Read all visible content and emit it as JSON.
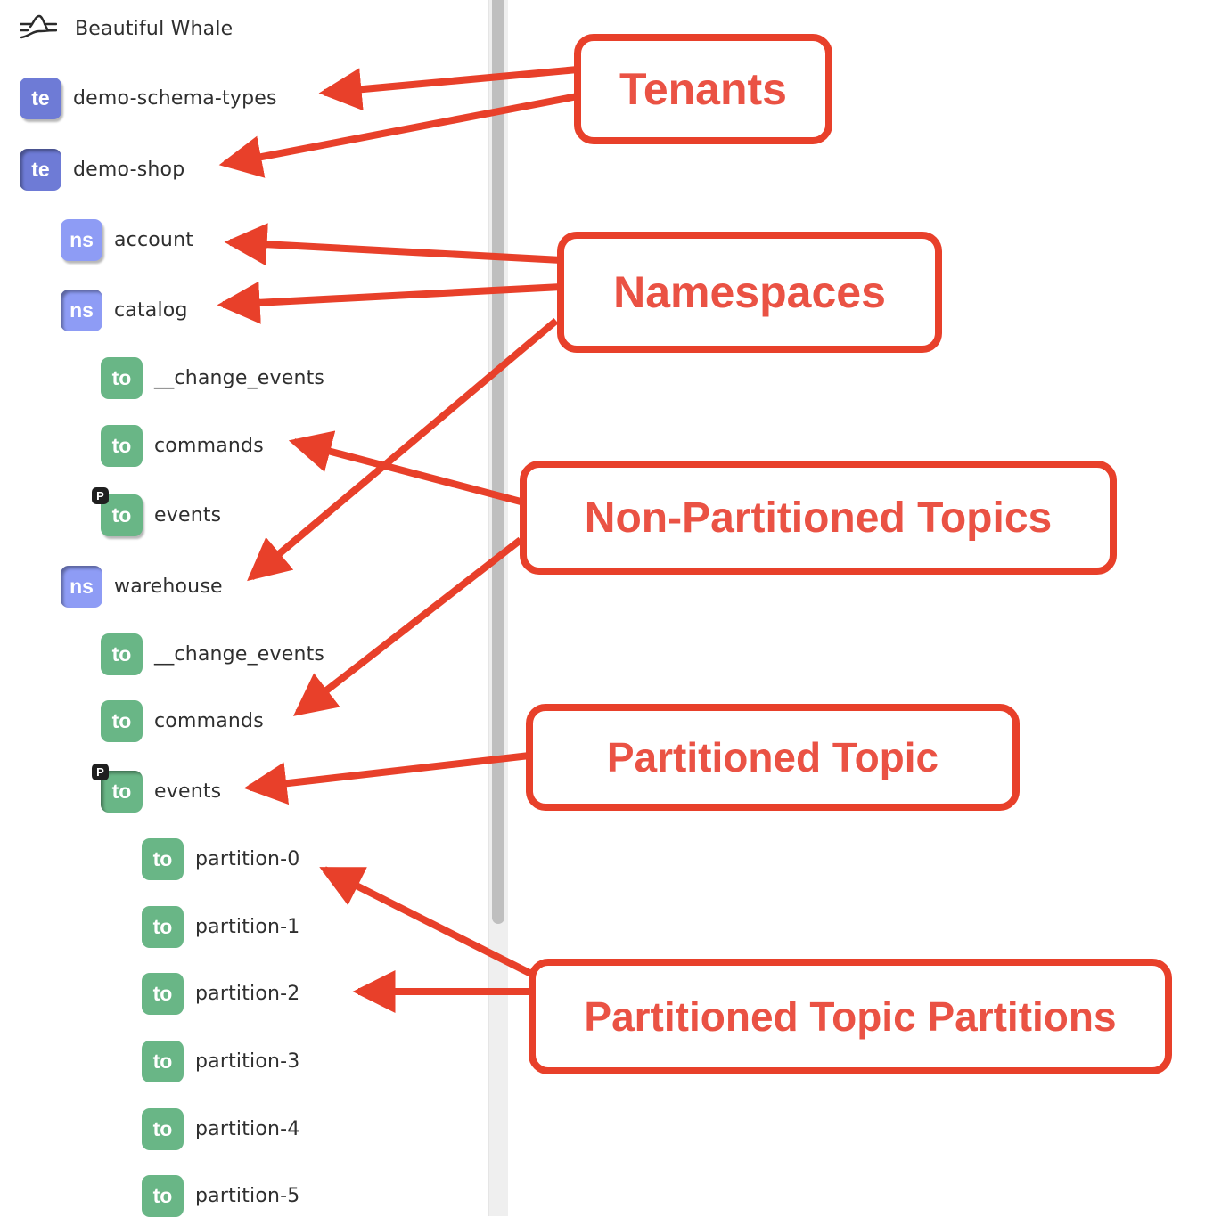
{
  "app": {
    "title": "Beautiful Whale",
    "logo_icon": "wave-mountain-icon"
  },
  "tree": [
    {
      "kind": "te",
      "badge": "te",
      "label": "demo-schema-types",
      "state": "collapsed",
      "partitioned": false
    },
    {
      "kind": "te",
      "badge": "te",
      "label": "demo-shop",
      "state": "expanded",
      "partitioned": false
    },
    {
      "kind": "ns",
      "badge": "ns",
      "label": "account",
      "state": "collapsed",
      "partitioned": false
    },
    {
      "kind": "ns",
      "badge": "ns",
      "label": "catalog",
      "state": "expanded",
      "partitioned": false
    },
    {
      "kind": "to",
      "badge": "to",
      "label": "__change_events",
      "state": "leaf",
      "partitioned": false
    },
    {
      "kind": "to",
      "badge": "to",
      "label": "commands",
      "state": "leaf",
      "partitioned": false
    },
    {
      "kind": "to",
      "badge": "to",
      "label": "events",
      "state": "collapsed",
      "partitioned": true,
      "partition_mark": "P"
    },
    {
      "kind": "ns",
      "badge": "ns",
      "label": "warehouse",
      "state": "expanded",
      "partitioned": false
    },
    {
      "kind": "to",
      "badge": "to",
      "label": "__change_events",
      "state": "leaf",
      "partitioned": false
    },
    {
      "kind": "to",
      "badge": "to",
      "label": "commands",
      "state": "leaf",
      "partitioned": false
    },
    {
      "kind": "to",
      "badge": "to",
      "label": "events",
      "state": "expanded",
      "partitioned": true,
      "partition_mark": "P"
    },
    {
      "kind": "to",
      "badge": "to",
      "label": "partition-0",
      "state": "leaf",
      "partitioned": false
    },
    {
      "kind": "to",
      "badge": "to",
      "label": "partition-1",
      "state": "leaf",
      "partitioned": false
    },
    {
      "kind": "to",
      "badge": "to",
      "label": "partition-2",
      "state": "leaf",
      "partitioned": false
    },
    {
      "kind": "to",
      "badge": "to",
      "label": "partition-3",
      "state": "leaf",
      "partitioned": false
    },
    {
      "kind": "to",
      "badge": "to",
      "label": "partition-4",
      "state": "leaf",
      "partitioned": false
    },
    {
      "kind": "to",
      "badge": "to",
      "label": "partition-5",
      "state": "leaf",
      "partitioned": false
    }
  ],
  "annotations": {
    "tenants": "Tenants",
    "namespaces": "Namespaces",
    "non_partitioned_topics": "Non-Partitioned Topics",
    "partitioned_topic": "Partitioned Topic",
    "partitioned_topic_partitions": "Partitioned Topic Partitions"
  },
  "colors": {
    "tenant_badge": "#6e7bd6",
    "namespace_badge": "#8e9cf5",
    "topic_badge": "#69b686",
    "annotation_red": "#e8402a"
  }
}
